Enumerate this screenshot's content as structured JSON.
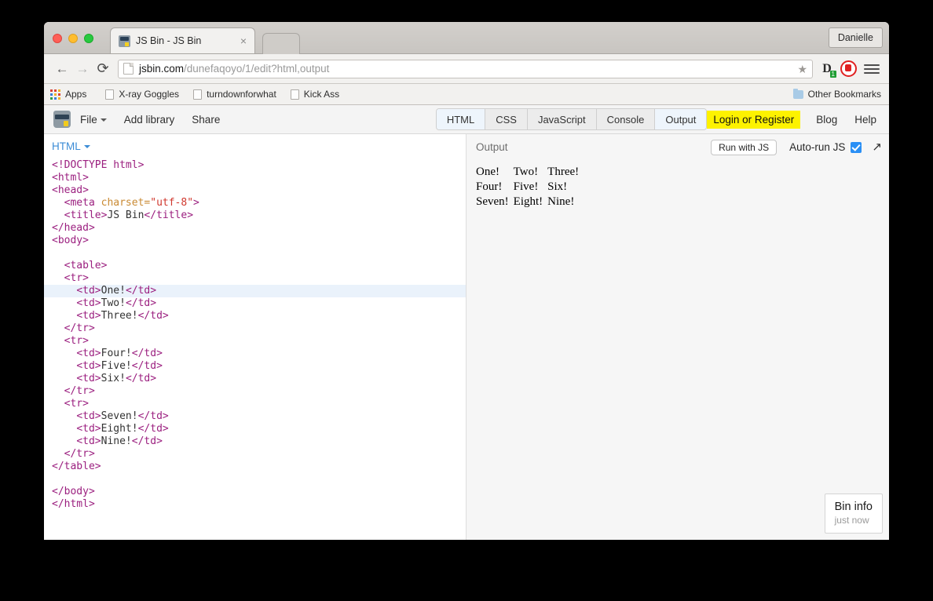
{
  "browser": {
    "profile_button": "Danielle",
    "tab": {
      "title": "JS Bin - JS Bin",
      "close": "×"
    },
    "nav": {
      "back": "←",
      "forward": "→",
      "reload": "⟳"
    },
    "omnibox": {
      "domain": "jsbin.com",
      "path": "/dunefaqoyo/1/edit?html,output",
      "star": "★"
    },
    "extensions": {
      "d_letter": "D",
      "d_badge": "1"
    },
    "bookmarks": [
      {
        "label": "Apps",
        "icon": "apps-grid-icon"
      },
      {
        "label": "X-ray Goggles",
        "icon": "doc-icon"
      },
      {
        "label": "turndownforwhat",
        "icon": "doc-icon"
      },
      {
        "label": "Kick Ass",
        "icon": "doc-icon"
      }
    ],
    "other_bookmarks": "Other Bookmarks"
  },
  "jsbin": {
    "menu": [
      {
        "label": "File",
        "has_caret": true
      },
      {
        "label": "Add library",
        "has_caret": false
      },
      {
        "label": "Share",
        "has_caret": false
      }
    ],
    "panel_tabs": [
      {
        "label": "HTML",
        "active": true
      },
      {
        "label": "CSS",
        "active": false
      },
      {
        "label": "JavaScript",
        "active": false
      },
      {
        "label": "Console",
        "active": false
      },
      {
        "label": "Output",
        "active": true
      }
    ],
    "login": "Login or Register",
    "blog": "Blog",
    "help": "Help",
    "highlight_color": "#fdf200"
  },
  "editor": {
    "label": "HTML",
    "active_line_index": 10,
    "lines": [
      [
        {
          "t": "tag",
          "s": "<!DOCTYPE html>"
        }
      ],
      [
        {
          "t": "tag",
          "s": "<html>"
        }
      ],
      [
        {
          "t": "tag",
          "s": "<head>"
        }
      ],
      [
        {
          "t": "txt",
          "s": "  "
        },
        {
          "t": "tag",
          "s": "<meta "
        },
        {
          "t": "attr",
          "s": "charset="
        },
        {
          "t": "str",
          "s": "\"utf-8\""
        },
        {
          "t": "tag",
          "s": ">"
        }
      ],
      [
        {
          "t": "txt",
          "s": "  "
        },
        {
          "t": "tag",
          "s": "<title>"
        },
        {
          "t": "txt",
          "s": "JS Bin"
        },
        {
          "t": "tag",
          "s": "</title>"
        }
      ],
      [
        {
          "t": "tag",
          "s": "</head>"
        }
      ],
      [
        {
          "t": "tag",
          "s": "<body>"
        }
      ],
      [
        {
          "t": "txt",
          "s": ""
        }
      ],
      [
        {
          "t": "txt",
          "s": "  "
        },
        {
          "t": "tag",
          "s": "<table>"
        }
      ],
      [
        {
          "t": "txt",
          "s": "  "
        },
        {
          "t": "tag",
          "s": "<tr>"
        }
      ],
      [
        {
          "t": "txt",
          "s": "    "
        },
        {
          "t": "tag",
          "s": "<td>"
        },
        {
          "t": "txt",
          "s": "One!"
        },
        {
          "t": "tag",
          "s": "</td>"
        }
      ],
      [
        {
          "t": "txt",
          "s": "    "
        },
        {
          "t": "tag",
          "s": "<td>"
        },
        {
          "t": "txt",
          "s": "Two!"
        },
        {
          "t": "tag",
          "s": "</td>"
        }
      ],
      [
        {
          "t": "txt",
          "s": "    "
        },
        {
          "t": "tag",
          "s": "<td>"
        },
        {
          "t": "txt",
          "s": "Three!"
        },
        {
          "t": "tag",
          "s": "</td>"
        }
      ],
      [
        {
          "t": "txt",
          "s": "  "
        },
        {
          "t": "tag",
          "s": "</tr>"
        }
      ],
      [
        {
          "t": "txt",
          "s": "  "
        },
        {
          "t": "tag",
          "s": "<tr>"
        }
      ],
      [
        {
          "t": "txt",
          "s": "    "
        },
        {
          "t": "tag",
          "s": "<td>"
        },
        {
          "t": "txt",
          "s": "Four!"
        },
        {
          "t": "tag",
          "s": "</td>"
        }
      ],
      [
        {
          "t": "txt",
          "s": "    "
        },
        {
          "t": "tag",
          "s": "<td>"
        },
        {
          "t": "txt",
          "s": "Five!"
        },
        {
          "t": "tag",
          "s": "</td>"
        }
      ],
      [
        {
          "t": "txt",
          "s": "    "
        },
        {
          "t": "tag",
          "s": "<td>"
        },
        {
          "t": "txt",
          "s": "Six!"
        },
        {
          "t": "tag",
          "s": "</td>"
        }
      ],
      [
        {
          "t": "txt",
          "s": "  "
        },
        {
          "t": "tag",
          "s": "</tr>"
        }
      ],
      [
        {
          "t": "txt",
          "s": "  "
        },
        {
          "t": "tag",
          "s": "<tr>"
        }
      ],
      [
        {
          "t": "txt",
          "s": "    "
        },
        {
          "t": "tag",
          "s": "<td>"
        },
        {
          "t": "txt",
          "s": "Seven!"
        },
        {
          "t": "tag",
          "s": "</td>"
        }
      ],
      [
        {
          "t": "txt",
          "s": "    "
        },
        {
          "t": "tag",
          "s": "<td>"
        },
        {
          "t": "txt",
          "s": "Eight!"
        },
        {
          "t": "tag",
          "s": "</td>"
        }
      ],
      [
        {
          "t": "txt",
          "s": "    "
        },
        {
          "t": "tag",
          "s": "<td>"
        },
        {
          "t": "txt",
          "s": "Nine!"
        },
        {
          "t": "tag",
          "s": "</td>"
        }
      ],
      [
        {
          "t": "txt",
          "s": "  "
        },
        {
          "t": "tag",
          "s": "</tr>"
        }
      ],
      [
        {
          "t": "tag",
          "s": "</table>"
        }
      ],
      [
        {
          "t": "txt",
          "s": ""
        }
      ],
      [
        {
          "t": "tag",
          "s": "</body>"
        }
      ],
      [
        {
          "t": "tag",
          "s": "</html>"
        }
      ]
    ]
  },
  "output": {
    "title": "Output",
    "run_button": "Run with JS",
    "autorun_label": "Auto-run JS",
    "autorun_checked": true,
    "expand_icon": "↗",
    "rendered_table": [
      [
        "One!",
        "Two!",
        "Three!"
      ],
      [
        "Four!",
        "Five!",
        "Six!"
      ],
      [
        "Seven!",
        "Eight!",
        "Nine!"
      ]
    ],
    "bin_info": {
      "title": "Bin info",
      "subtitle": "just now"
    }
  }
}
